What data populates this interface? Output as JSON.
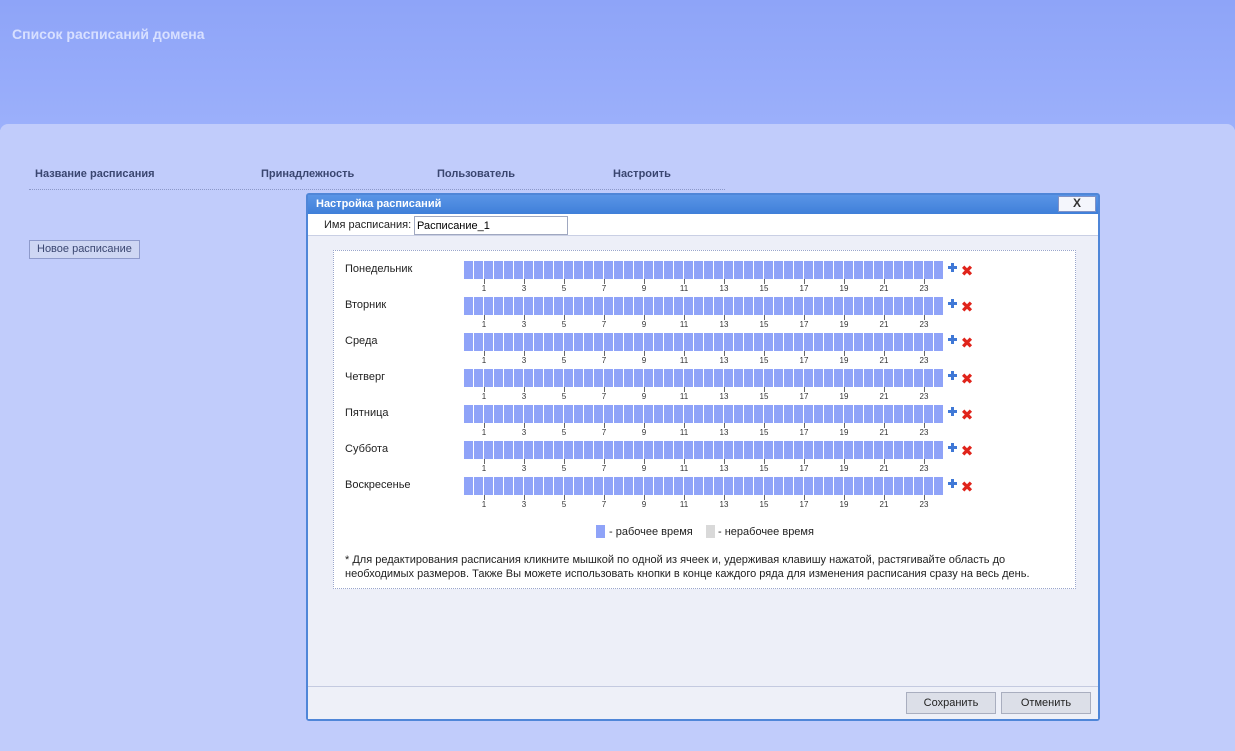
{
  "page": {
    "title": "Список расписаний домена"
  },
  "table": {
    "columns": [
      "Название расписания",
      "Принадлежность",
      "Пользователь",
      "Настроить"
    ]
  },
  "new_schedule_button": "Новое расписание",
  "dialog": {
    "title": "Настройка расписаний",
    "close_label": "X",
    "name_label": "Имя расписания:",
    "name_value": "Расписание_1",
    "days": [
      "Понедельник",
      "Вторник",
      "Среда",
      "Четверг",
      "Пятница",
      "Суббота",
      "Воскресенье"
    ],
    "hour_labels": [
      "1",
      "3",
      "5",
      "7",
      "9",
      "11",
      "13",
      "15",
      "17",
      "19",
      "21",
      "23"
    ],
    "half_hour_cells_per_day": 48,
    "all_cells_working": true,
    "legend": {
      "working": "- рабочее время",
      "nonworking": "- нерабочее время"
    },
    "colors": {
      "working": "#8fa3f8",
      "nonworking": "#d9d9d9",
      "add": "#3f78d6",
      "delete": "#e0241b",
      "title_bar": "#4f86d8"
    },
    "icons": {
      "add_row": "plus-icon",
      "clear_row": "close-icon"
    },
    "note": "* Для редактирования расписания кликните мышкой по одной из ячеек и, удерживая клавишу нажатой, растягивайте область до необходимых размеров. Также Вы можете использовать кнопки в конце каждого ряда для изменения расписания сразу на весь день.",
    "save_label": "Сохранить",
    "cancel_label": "Отменить"
  }
}
